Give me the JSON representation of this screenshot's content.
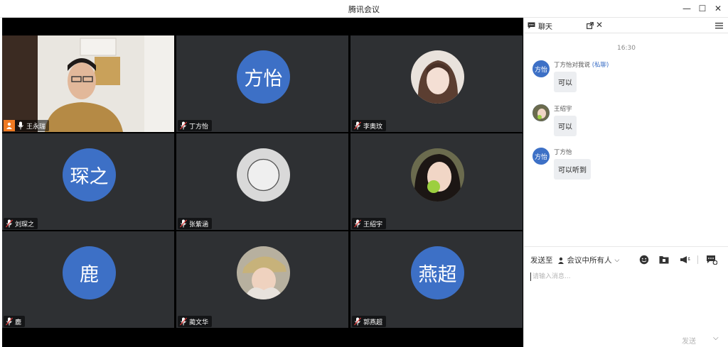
{
  "window": {
    "title": "腾讯会议"
  },
  "participants": [
    {
      "name": "王永瑞",
      "avatar_text": "",
      "host": true
    },
    {
      "name": "丁方怡",
      "avatar_text": "方怡",
      "host": false
    },
    {
      "name": "李奥玟",
      "avatar_text": "",
      "host": false
    },
    {
      "name": "刘琛之",
      "avatar_text": "琛之",
      "host": false
    },
    {
      "name": "张紫涵",
      "avatar_text": "",
      "host": false
    },
    {
      "name": "王绍宇",
      "avatar_text": "",
      "host": false
    },
    {
      "name": "鹿",
      "avatar_text": "鹿",
      "host": false
    },
    {
      "name": "蔺文华",
      "avatar_text": "",
      "host": false
    },
    {
      "name": "郭燕超",
      "avatar_text": "燕超",
      "host": false
    }
  ],
  "chat": {
    "title": "聊天",
    "time": "16:30",
    "messages": [
      {
        "avatar_text": "方怡",
        "sender": "丁方怡对我说",
        "private_tag": "(私聊)",
        "text": "可以"
      },
      {
        "avatar_text": "",
        "sender": "王绍宇",
        "private_tag": "",
        "text": "可以"
      },
      {
        "avatar_text": "方怡",
        "sender": "丁方怡",
        "private_tag": "",
        "text": "可以听到"
      }
    ],
    "send_to_label": "发送至",
    "send_to_value": "会议中所有人",
    "input_placeholder": "请输入消息...",
    "send_label": "发送"
  }
}
